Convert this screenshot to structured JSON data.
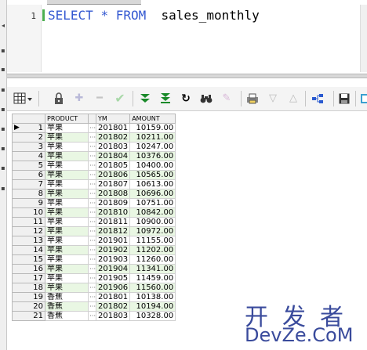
{
  "editor": {
    "line_number": "1",
    "sql_keyword_select": "SELECT",
    "sql_star": "*",
    "sql_keyword_from": "FROM",
    "sql_table": "sales_monthly"
  },
  "toolbar_icons": [
    "grid-menu-icon",
    "lock-icon",
    "add-row-icon",
    "delete-row-icon",
    "post-check-icon",
    "fetch-next-icon",
    "fetch-all-icon",
    "refresh-icon",
    "find-icon",
    "clear-icon",
    "print-icon",
    "filter-down-icon",
    "filter-up-icon",
    "connect-icon",
    "save-icon",
    "export-icon"
  ],
  "grid": {
    "columns": [
      "PRODUCT",
      "YM",
      "AMOUNT"
    ],
    "rows": [
      {
        "n": "1",
        "product": "苹果",
        "ym": "201801",
        "amount": "10159.00"
      },
      {
        "n": "2",
        "product": "苹果",
        "ym": "201802",
        "amount": "10211.00"
      },
      {
        "n": "3",
        "product": "苹果",
        "ym": "201803",
        "amount": "10247.00"
      },
      {
        "n": "4",
        "product": "苹果",
        "ym": "201804",
        "amount": "10376.00"
      },
      {
        "n": "5",
        "product": "苹果",
        "ym": "201805",
        "amount": "10400.00"
      },
      {
        "n": "6",
        "product": "苹果",
        "ym": "201806",
        "amount": "10565.00"
      },
      {
        "n": "7",
        "product": "苹果",
        "ym": "201807",
        "amount": "10613.00"
      },
      {
        "n": "8",
        "product": "苹果",
        "ym": "201808",
        "amount": "10696.00"
      },
      {
        "n": "9",
        "product": "苹果",
        "ym": "201809",
        "amount": "10751.00"
      },
      {
        "n": "10",
        "product": "苹果",
        "ym": "201810",
        "amount": "10842.00"
      },
      {
        "n": "11",
        "product": "苹果",
        "ym": "201811",
        "amount": "10900.00"
      },
      {
        "n": "12",
        "product": "苹果",
        "ym": "201812",
        "amount": "10972.00"
      },
      {
        "n": "13",
        "product": "苹果",
        "ym": "201901",
        "amount": "11155.00"
      },
      {
        "n": "14",
        "product": "苹果",
        "ym": "201902",
        "amount": "11202.00"
      },
      {
        "n": "15",
        "product": "苹果",
        "ym": "201903",
        "amount": "11260.00"
      },
      {
        "n": "16",
        "product": "苹果",
        "ym": "201904",
        "amount": "11341.00"
      },
      {
        "n": "17",
        "product": "苹果",
        "ym": "201905",
        "amount": "11459.00"
      },
      {
        "n": "18",
        "product": "苹果",
        "ym": "201906",
        "amount": "11560.00"
      },
      {
        "n": "19",
        "product": "香蕉",
        "ym": "201801",
        "amount": "10138.00"
      },
      {
        "n": "20",
        "product": "香蕉",
        "ym": "201802",
        "amount": "10194.00"
      },
      {
        "n": "21",
        "product": "香蕉",
        "ym": "201803",
        "amount": "10328.00"
      }
    ]
  },
  "watermark": {
    "top": "开发者",
    "bottom": "DevZe.CoM"
  },
  "colors": {
    "keyword": "#3358d1",
    "row_alt": "#e9f7e3",
    "watermark": "#3a4b9c"
  }
}
